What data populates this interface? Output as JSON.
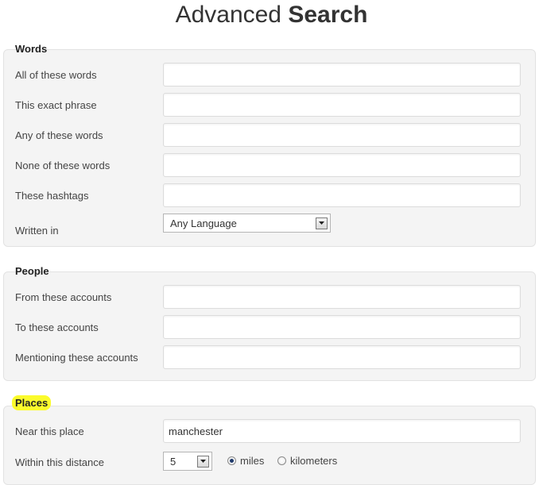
{
  "page": {
    "title_light": "Advanced",
    "title_bold": "Search"
  },
  "words": {
    "legend": "Words",
    "fields": [
      {
        "label": "All of these words",
        "value": ""
      },
      {
        "label": "This exact phrase",
        "value": ""
      },
      {
        "label": "Any of these words",
        "value": ""
      },
      {
        "label": "None of these words",
        "value": ""
      },
      {
        "label": "These hashtags",
        "value": ""
      }
    ],
    "language": {
      "label": "Written in",
      "selected": "Any Language"
    }
  },
  "people": {
    "legend": "People",
    "fields": [
      {
        "label": "From these accounts",
        "value": ""
      },
      {
        "label": "To these accounts",
        "value": ""
      },
      {
        "label": "Mentioning these accounts",
        "value": ""
      }
    ]
  },
  "places": {
    "legend": "Places",
    "legend_highlight_color": "#fbfb2c",
    "near": {
      "label": "Near this place",
      "value": "manchester"
    },
    "distance": {
      "label": "Within this distance",
      "selected": "5",
      "units": [
        {
          "label": "miles",
          "checked": true
        },
        {
          "label": "kilometers",
          "checked": false
        }
      ]
    }
  }
}
